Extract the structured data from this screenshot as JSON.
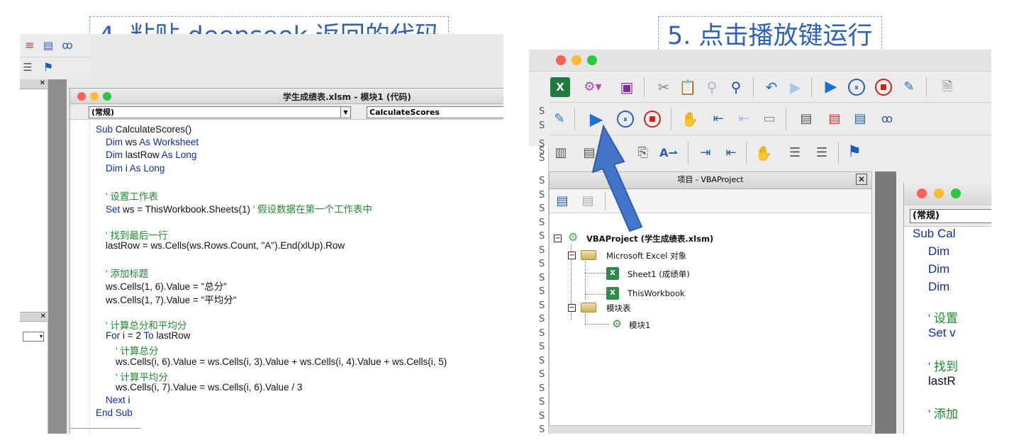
{
  "step4": {
    "title": "4. 粘贴 deepseek 返回的代码"
  },
  "step5": {
    "title": "5. 点击播放键运行"
  },
  "left_editor": {
    "window_title": "学生成绩表.xlsm - 模块1 (代码)",
    "object_combo": "(常规)",
    "procedure_combo": "CalculateScores",
    "code_lines": [
      {
        "t": "Sub CalculateScores()",
        "c": "kw-mix1"
      },
      {
        "t": "Dim ws As Worksheet",
        "c": "kw-mix2"
      },
      {
        "t": "Dim lastRow As Long",
        "c": "kw-mix3"
      },
      {
        "t": "Dim i As Long",
        "c": "kw"
      },
      {
        "t": "",
        "c": ""
      },
      {
        "t": "' 设置工作表",
        "c": "cm"
      },
      {
        "t": "Set ws = ThisWorkbook.Sheets(1) ' 假设数据在第一个工作表中",
        "c": "mix-set"
      },
      {
        "t": "",
        "c": ""
      },
      {
        "t": "' 找到最后一行",
        "c": "cm"
      },
      {
        "t": "lastRow = ws.Cells(ws.Rows.Count, \"A\").End(xlUp).Row",
        "c": ""
      },
      {
        "t": "",
        "c": ""
      },
      {
        "t": "' 添加标题",
        "c": "cm"
      },
      {
        "t": "ws.Cells(1, 6).Value = \"总分\"",
        "c": ""
      },
      {
        "t": "ws.Cells(1, 7).Value = \"平均分\"",
        "c": ""
      },
      {
        "t": "",
        "c": ""
      },
      {
        "t": "' 计算总分和平均分",
        "c": "cm"
      },
      {
        "t": "For i = 2 To lastRow",
        "c": "mix-for"
      },
      {
        "t": "' 计算总分",
        "c": "cm"
      },
      {
        "t": "ws.Cells(i, 6).Value = ws.Cells(i, 3).Value + ws.Cells(i, 4).Value + ws.Cells(i, 5)",
        "c": ""
      },
      {
        "t": "' 计算平均分",
        "c": "cm"
      },
      {
        "t": "ws.Cells(i, 7).Value = ws.Cells(i, 6).Value / 3",
        "c": ""
      },
      {
        "t": "Next i",
        "c": "mix-next"
      },
      {
        "t": "End Sub",
        "c": "kw"
      }
    ]
  },
  "project_pane": {
    "title": "项目 - VBAProject",
    "root": "VBAProject (学生成绩表.xlsm)",
    "folder_objects": "Microsoft Excel 对象",
    "sheet1": "Sheet1 (成绩单)",
    "thisworkbook": "ThisWorkbook",
    "folder_modules": "模块表",
    "module1": "模块1"
  },
  "right_editor": {
    "object_combo": "(常规)",
    "code_fragments": [
      "Sub Cal",
      "Dim",
      "Dim",
      "Dim",
      "' 设置",
      "Set v",
      "' 找到",
      "lastR",
      "' 添加"
    ]
  },
  "sheet_column_letter": "S",
  "colors": {
    "accent_blue": "#2d62b8",
    "keyword_blue": "#0a2ea8",
    "comment_green": "#1f8a2e",
    "run_blue": "#1d6fd1",
    "stop_red": "#c0281e"
  },
  "icons": [
    "excel-icon",
    "save-icon",
    "cut-icon",
    "paste-icon",
    "find-icon",
    "undo-icon",
    "run-icon",
    "pause-icon",
    "stop-icon",
    "design-mode-icon",
    "hand-icon",
    "indent-icon",
    "outdent-icon",
    "flag-icon",
    "glasses-icon",
    "annotation-arrow"
  ]
}
